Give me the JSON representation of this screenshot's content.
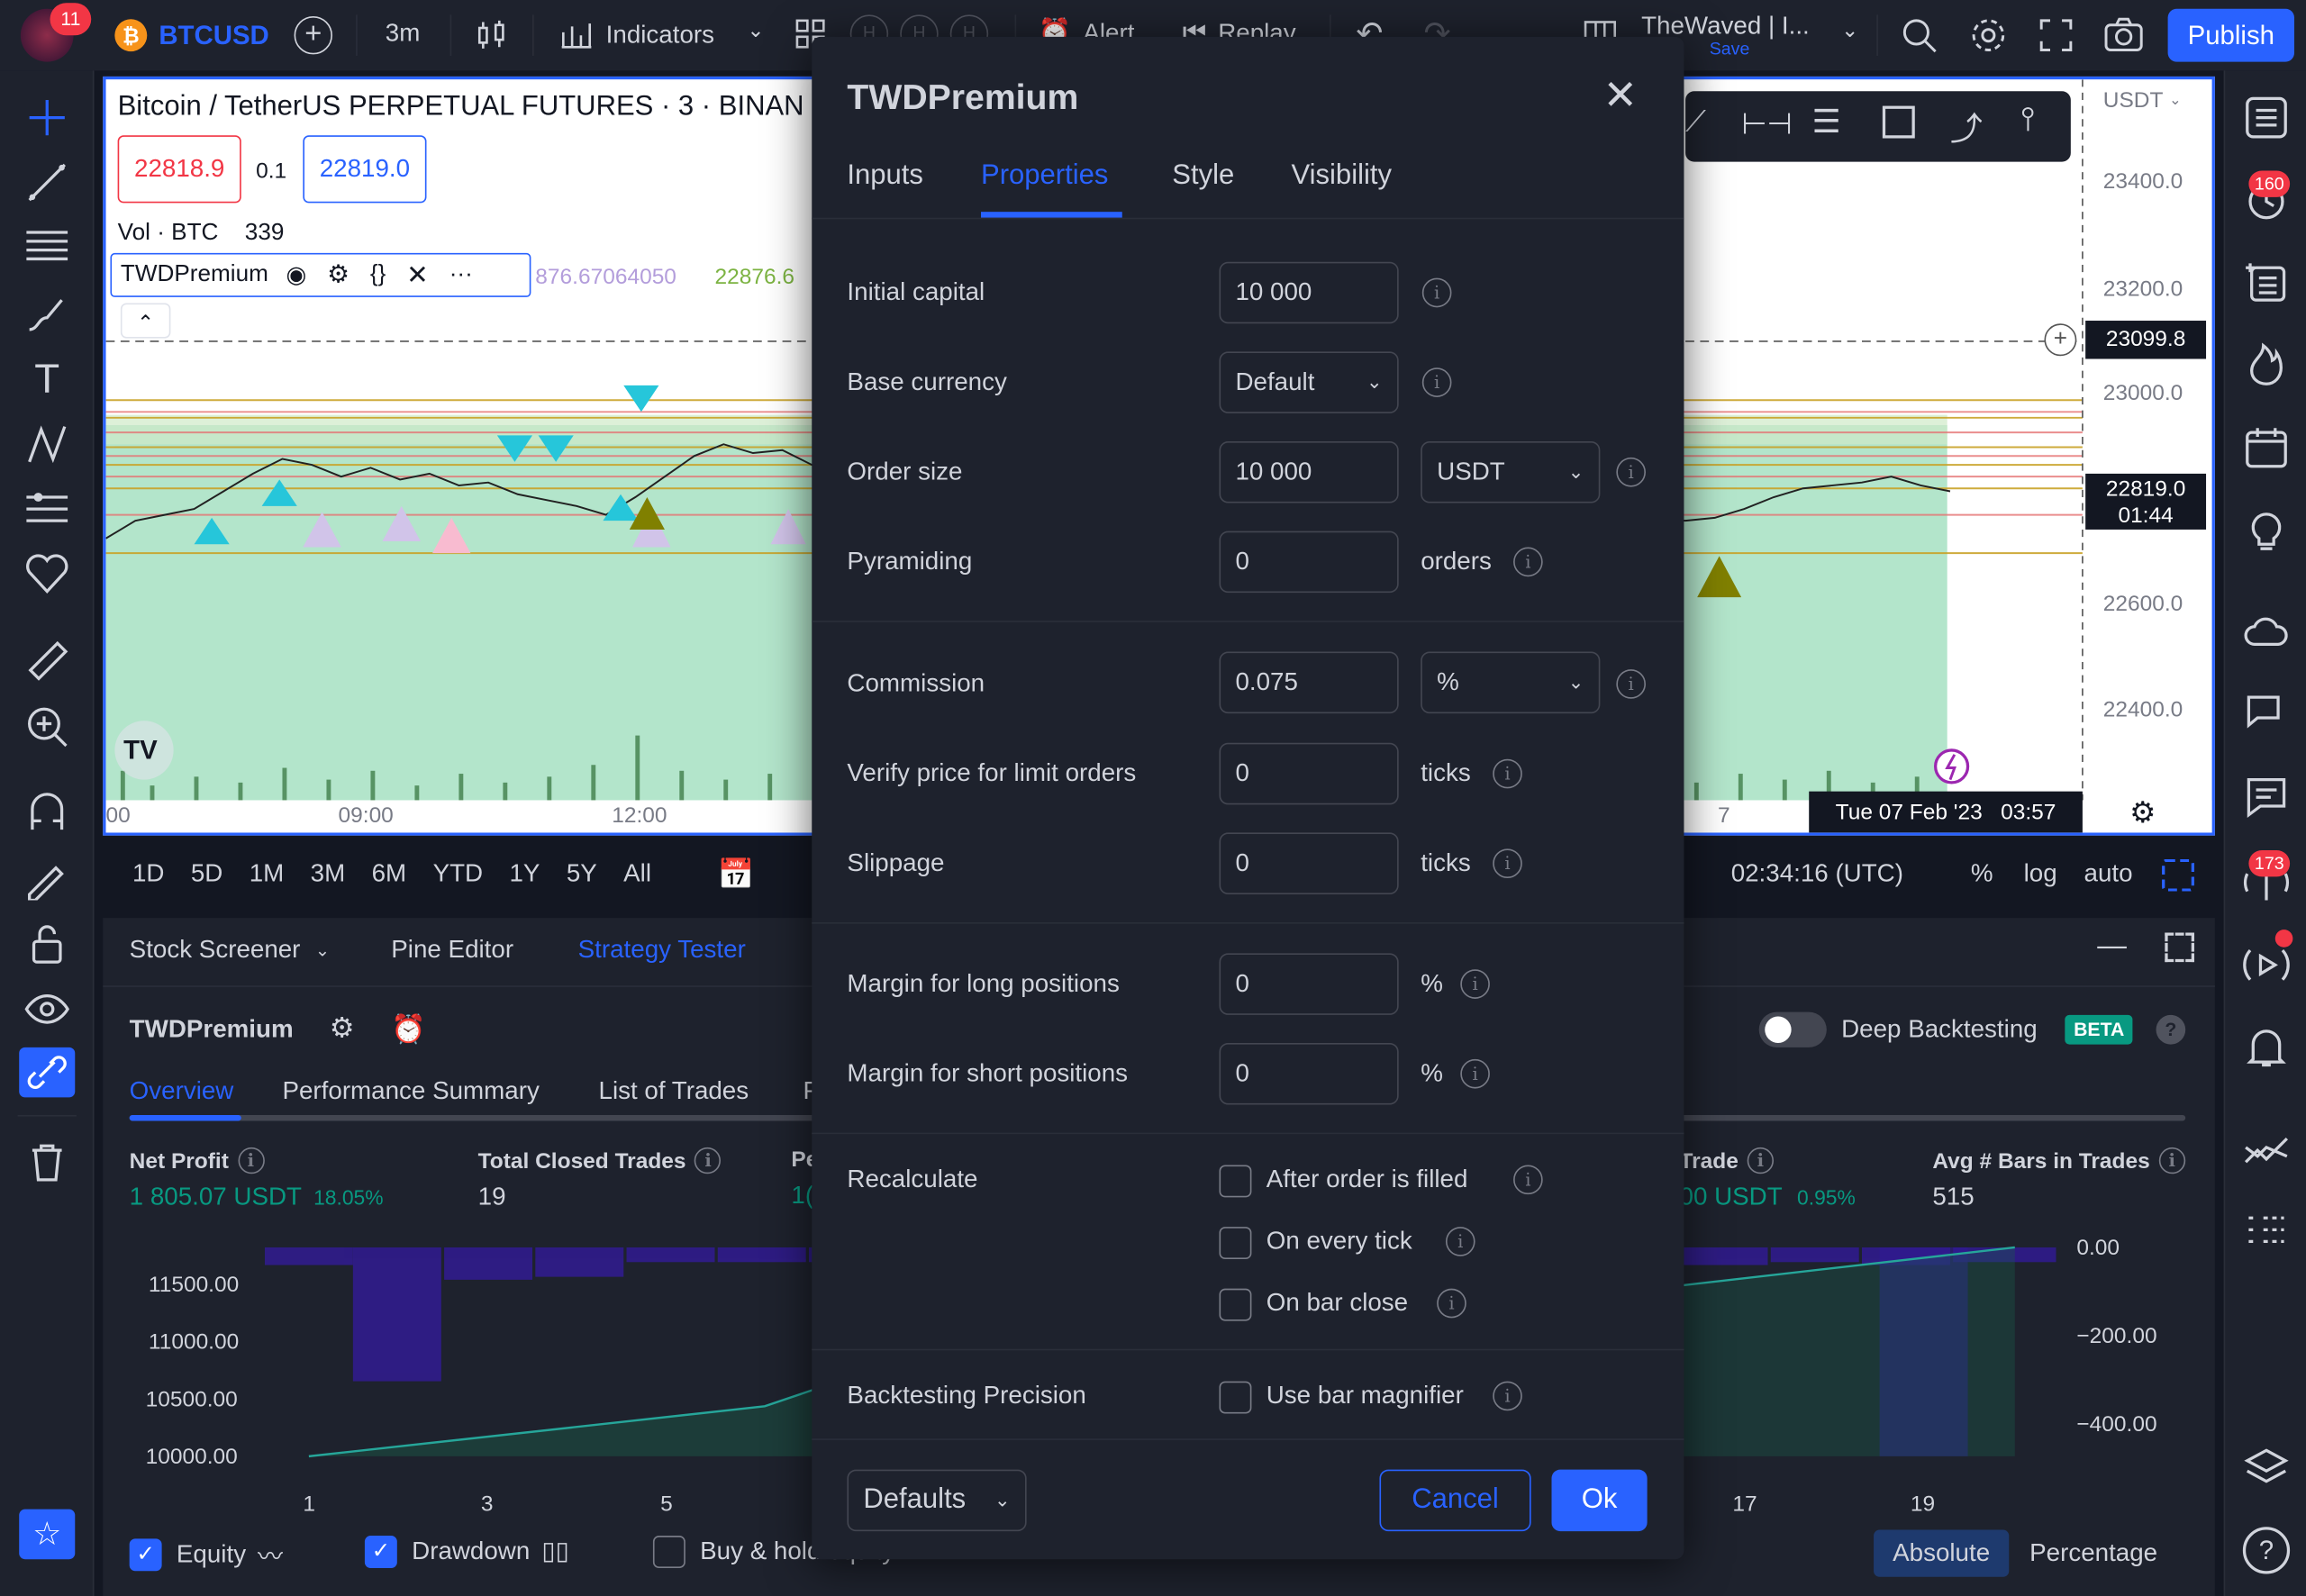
{
  "topbar": {
    "notif_count": "11",
    "symbol": "BTCUSD",
    "interval": "3m",
    "indicators": "Indicators",
    "alert": "Alert",
    "replay": "Replay",
    "layout_name": "TheWaved | I...",
    "save": "Save",
    "publish": "Publish"
  },
  "chart": {
    "title": "Bitcoin / TetherUS PERPETUAL FUTURES · 3 · BINAN",
    "bid": "22818.9",
    "spread": "0.1",
    "ask": "22819.0",
    "vol_label": "Vol · BTC",
    "vol_value": "339",
    "indicator_name": "TWDPremium",
    "indicator_values": "876.67064050",
    "indicator_value2": "22876.6",
    "currency": "USDT",
    "price_levels": [
      "23400.0",
      "23200.0",
      "23000.0",
      "22600.0",
      "22400.0"
    ],
    "crosshair_price": "23099.8",
    "last_price": "22819.0",
    "countdown": "01:44",
    "time_labels": [
      "00",
      "09:00",
      "12:00",
      "7"
    ],
    "crosshair_time": "Tue 07 Feb '23   03:57",
    "markers": [
      "v",
      "v",
      "R6",
      "R7",
      "R6",
      "v",
      "R3",
      "R7",
      "R7",
      "R3",
      "v",
      "v",
      "v",
      "v"
    ]
  },
  "rangebar": {
    "ranges": [
      "1D",
      "5D",
      "1M",
      "3M",
      "6M",
      "YTD",
      "1Y",
      "5Y",
      "All"
    ],
    "clock": "02:34:16 (UTC)",
    "pct": "%",
    "log": "log",
    "auto": "auto"
  },
  "bottom": {
    "tabs": [
      "Stock Screener",
      "Pine Editor",
      "Strategy Tester"
    ],
    "strategy": "TWDPremium",
    "deep": "Deep Backtesting",
    "beta": "BETA",
    "subtabs": [
      "Overview",
      "Performance Summary",
      "List of Trades",
      "P"
    ],
    "metrics": [
      {
        "label": "Net Profit",
        "value": "1 805.07 USDT",
        "pct": "18.05%"
      },
      {
        "label": "Total Closed Trades",
        "value": "19"
      },
      {
        "label": "Pe",
        "value": "1("
      },
      {
        "label": "Trade",
        "value": "00 USDT",
        "pct": "0.95%"
      },
      {
        "label": "Avg # Bars in Trades",
        "value": "515"
      }
    ],
    "left_axis": [
      "11500.00",
      "11000.00",
      "10500.00",
      "10000.00"
    ],
    "right_axis": [
      "0.00",
      "−200.00",
      "−400.00"
    ],
    "x_axis": [
      "1",
      "3",
      "5",
      "17",
      "19"
    ],
    "legend": [
      "Equity",
      "Drawdown",
      "Buy & hold equity"
    ],
    "absolute": "Absolute",
    "percentage": "Percentage"
  },
  "dialog": {
    "title": "TWDPremium",
    "tabs": [
      "Inputs",
      "Properties",
      "Style",
      "Visibility"
    ],
    "initial_capital_label": "Initial capital",
    "initial_capital": "10 000",
    "base_currency_label": "Base currency",
    "base_currency": "Default",
    "order_size_label": "Order size",
    "order_size": "10 000",
    "order_size_unit": "USDT",
    "pyramiding_label": "Pyramiding",
    "pyramiding": "0",
    "pyramiding_unit": "orders",
    "commission_label": "Commission",
    "commission": "0.075",
    "commission_unit": "%",
    "verify_label": "Verify price for limit orders",
    "verify": "0",
    "verify_unit": "ticks",
    "slippage_label": "Slippage",
    "slippage": "0",
    "slippage_unit": "ticks",
    "margin_long_label": "Margin for long positions",
    "margin_long": "0",
    "margin_long_unit": "%",
    "margin_short_label": "Margin for short positions",
    "margin_short": "0",
    "margin_short_unit": "%",
    "recalc_label": "Recalculate",
    "recalc_opts": [
      "After order is filled",
      "On every tick",
      "On bar close"
    ],
    "precision_label": "Backtesting Precision",
    "magnifier": "Use bar magnifier",
    "defaults": "Defaults",
    "cancel": "Cancel",
    "ok": "Ok"
  },
  "right_badges": [
    "160",
    "173"
  ],
  "colors": {
    "accent": "#2962ff",
    "profit": "#089981",
    "purple": "#311b92",
    "teal": "#26a69a"
  }
}
